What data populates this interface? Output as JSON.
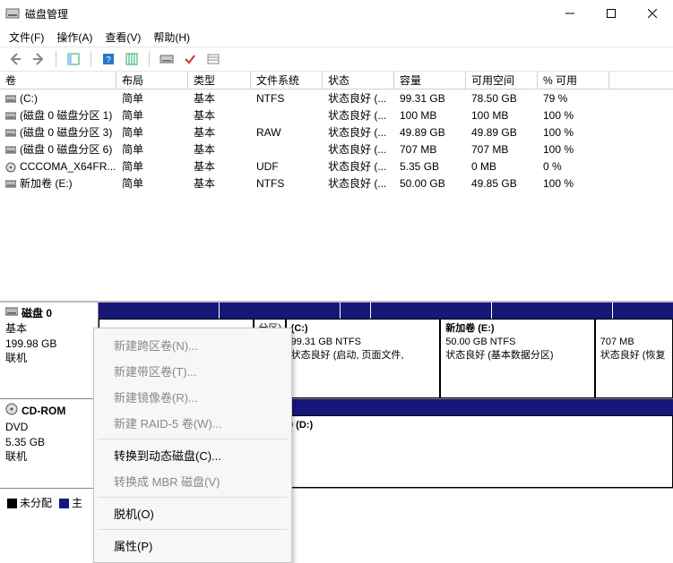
{
  "window": {
    "title": "磁盘管理",
    "min": "minimize",
    "max": "maximize",
    "close": "close"
  },
  "menubar": {
    "file": "文件(F)",
    "action": "操作(A)",
    "view": "查看(V)",
    "help": "帮助(H)"
  },
  "columns": {
    "name": "卷",
    "layout": "布局",
    "type": "类型",
    "fs": "文件系统",
    "status": "状态",
    "capacity": "容量",
    "free": "可用空间",
    "pct": "% 可用"
  },
  "volumes": [
    {
      "name": "(C:)",
      "layout": "简单",
      "type": "基本",
      "fs": "NTFS",
      "status": "状态良好 (...",
      "capacity": "99.31 GB",
      "free": "78.50 GB",
      "pct": "79 %"
    },
    {
      "name": "(磁盘 0 磁盘分区 1)",
      "layout": "简单",
      "type": "基本",
      "fs": "",
      "status": "状态良好 (...",
      "capacity": "100 MB",
      "free": "100 MB",
      "pct": "100 %"
    },
    {
      "name": "(磁盘 0 磁盘分区 3)",
      "layout": "简单",
      "type": "基本",
      "fs": "RAW",
      "status": "状态良好 (...",
      "capacity": "49.89 GB",
      "free": "49.89 GB",
      "pct": "100 %"
    },
    {
      "name": "(磁盘 0 磁盘分区 6)",
      "layout": "简单",
      "type": "基本",
      "fs": "",
      "status": "状态良好 (...",
      "capacity": "707 MB",
      "free": "707 MB",
      "pct": "100 %"
    },
    {
      "name": "CCCOMA_X64FR...",
      "layout": "简单",
      "type": "基本",
      "fs": "UDF",
      "status": "状态良好 (...",
      "capacity": "5.35 GB",
      "free": "0 MB",
      "pct": "0 %"
    },
    {
      "name": "新加卷 (E:)",
      "layout": "简单",
      "type": "基本",
      "fs": "NTFS",
      "status": "状态良好 (...",
      "capacity": "50.00 GB",
      "free": "49.85 GB",
      "pct": "100 %"
    }
  ],
  "disk0": {
    "name": "磁盘 0",
    "type": "基本",
    "size": "199.98 GB",
    "status": "联机",
    "parts": {
      "c": {
        "title": "(C:)",
        "line2": "99.31 GB NTFS",
        "line3": "状态良好 (启动, 页面文件,"
      },
      "spacer_label": "分区)",
      "e": {
        "title": "新加卷  (E:)",
        "line2": "50.00 GB NTFS",
        "line3": "状态良好 (基本数据分区)"
      },
      "last": {
        "title": "",
        "line2": "707 MB",
        "line3": "状态良好 (恢复"
      }
    }
  },
  "cdrom": {
    "name": "CD-ROM",
    "type": "DVD",
    "size": "5.35 GB",
    "status": "联机",
    "part": {
      "label": "9  (D:)"
    }
  },
  "legend": {
    "unalloc": "未分配",
    "primary": "主"
  },
  "context": {
    "span": "新建跨区卷(N)...",
    "striped": "新建带区卷(T)...",
    "mirror": "新建镜像卷(R)...",
    "raid5": "新建 RAID-5 卷(W)...",
    "todyn": "转换到动态磁盘(C)...",
    "tombr": "转换成 MBR 磁盘(V)",
    "offline": "脱机(O)",
    "props": "属性(P)"
  }
}
